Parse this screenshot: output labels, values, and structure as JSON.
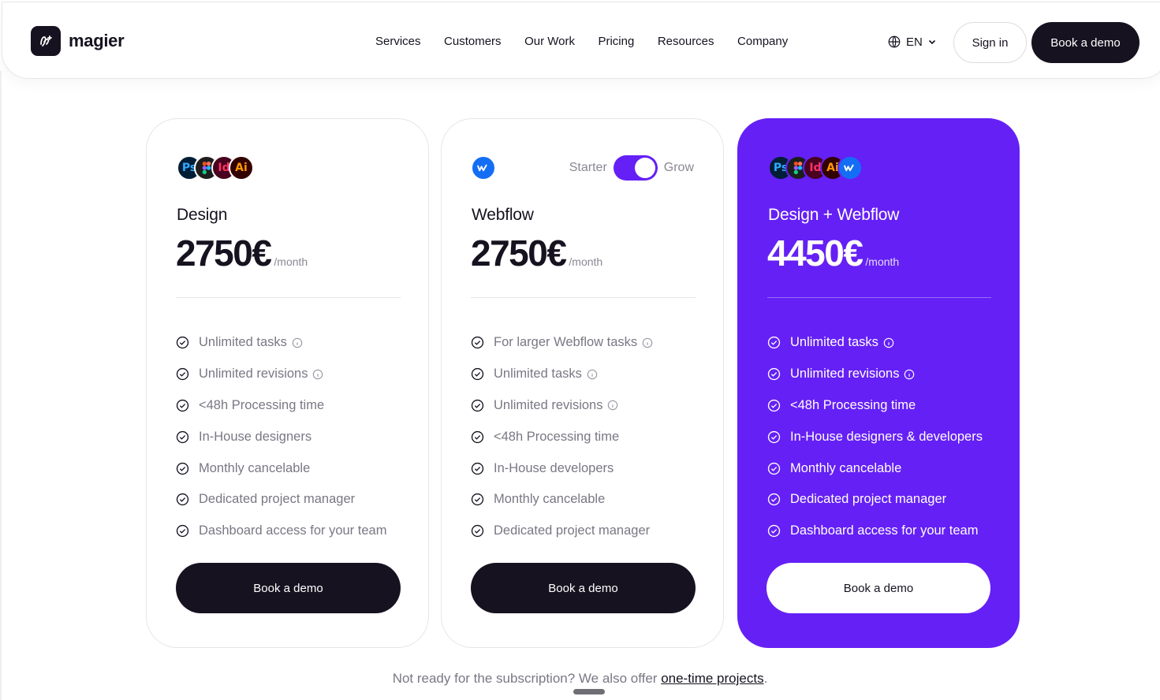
{
  "navbar": {
    "brand": "magier",
    "links": [
      "Services",
      "Customers",
      "Our Work",
      "Pricing",
      "Resources",
      "Company"
    ],
    "language": "EN",
    "sign_in": "Sign in",
    "book_demo": "Book a demo"
  },
  "plans": [
    {
      "name": "Design",
      "price": "2750€",
      "period": "/month",
      "tools": [
        "Ps",
        "Figma",
        "Id",
        "Ai"
      ],
      "features": [
        {
          "text": "Unlimited tasks",
          "info": true
        },
        {
          "text": "Unlimited revisions",
          "info": true
        },
        {
          "text": "<48h Processing time",
          "info": false
        },
        {
          "text": "In-House designers",
          "info": false
        },
        {
          "text": "Monthly cancelable",
          "info": false
        },
        {
          "text": "Dedicated project manager",
          "info": false
        },
        {
          "text": "Dashboard access for your team",
          "info": false
        }
      ],
      "cta": "Book a demo"
    },
    {
      "name": "Webflow",
      "price": "2750€",
      "period": "/month",
      "tools": [
        "Webflow"
      ],
      "toggle": {
        "left": "Starter",
        "right": "Grow",
        "active": "Grow"
      },
      "features": [
        {
          "text": "For larger Webflow tasks",
          "info": true
        },
        {
          "text": "Unlimited tasks",
          "info": true
        },
        {
          "text": "Unlimited revisions",
          "info": true
        },
        {
          "text": "<48h Processing time",
          "info": false
        },
        {
          "text": "In-House developers",
          "info": false
        },
        {
          "text": "Monthly cancelable",
          "info": false
        },
        {
          "text": "Dedicated project manager",
          "info": false
        }
      ],
      "cta": "Book a demo"
    },
    {
      "name": "Design + Webflow",
      "price": "4450€",
      "period": "/month",
      "tools": [
        "Ps",
        "Figma",
        "Id",
        "Ai",
        "Webflow"
      ],
      "highlighted": true,
      "features": [
        {
          "text": "Unlimited tasks",
          "info": true
        },
        {
          "text": "Unlimited revisions",
          "info": true
        },
        {
          "text": "<48h Processing time",
          "info": false
        },
        {
          "text": "In-House designers & developers",
          "info": false
        },
        {
          "text": "Monthly cancelable",
          "info": false
        },
        {
          "text": "Dedicated project manager",
          "info": false
        },
        {
          "text": "Dashboard access for your team",
          "info": false
        }
      ],
      "cta": "Book a demo"
    }
  ],
  "footnote": {
    "text": "Not ready for the subscription? We also offer ",
    "link": "one-time projects",
    "end": "."
  },
  "colors": {
    "accent": "#6520f5",
    "dark": "#16121f",
    "muted": "#7a7784"
  }
}
